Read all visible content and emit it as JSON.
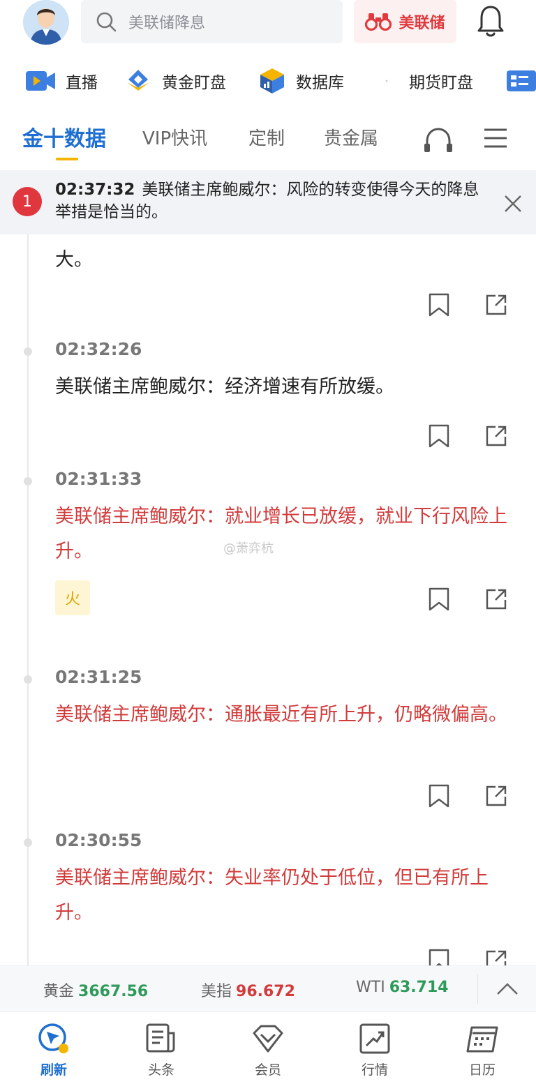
{
  "header": {
    "search_placeholder": "美联储降息",
    "brand_button": "美联储"
  },
  "quicknav": [
    {
      "label": "直播",
      "icon": "video-icon"
    },
    {
      "label": "黄金盯盘",
      "icon": "gold-icon"
    },
    {
      "label": "数据库",
      "icon": "database-icon"
    },
    {
      "label": "期货盯盘",
      "icon": "futures-icon"
    }
  ],
  "tabs": [
    {
      "label": "金十数据",
      "active": true
    },
    {
      "label": "VIP快讯",
      "active": false
    },
    {
      "label": "定制",
      "active": false
    },
    {
      "label": "贵金属",
      "active": false
    }
  ],
  "notice": {
    "badge": "1",
    "time": "02:37:32",
    "text": "美联储主席鲍威尔：风险的转变使得今天的降息举措是恰当的。"
  },
  "feed": {
    "partial_text": "大。",
    "watermark": "@萧弈杭",
    "entries": [
      {
        "time": "02:32:26",
        "text": "美联储主席鲍威尔：经济增速有所放缓。",
        "important": false
      },
      {
        "time": "02:31:33",
        "text": "美联储主席鲍威尔：就业增长已放缓，就业下行风险上升。",
        "important": true,
        "hot": "火"
      },
      {
        "time": "02:31:25",
        "text": "美联储主席鲍威尔：通胀最近有所上升，仍略微偏高。",
        "important": true
      },
      {
        "time": "02:30:55",
        "text": "美联储主席鲍威尔：失业率仍处于低位，但已有所上升。",
        "important": true
      }
    ]
  },
  "ticker": [
    {
      "name": "黄金",
      "value": "3667.56",
      "trend": "up"
    },
    {
      "name": "美指",
      "value": "96.672",
      "trend": "down"
    },
    {
      "name": "WTI",
      "value": "63.714",
      "trend": "up"
    }
  ],
  "bottomnav": [
    {
      "label": "刷新",
      "active": true
    },
    {
      "label": "头条",
      "active": false
    },
    {
      "label": "会员",
      "active": false
    },
    {
      "label": "行情",
      "active": false
    },
    {
      "label": "日历",
      "active": false
    }
  ],
  "colors": {
    "accent": "#1f6fd1",
    "important": "#d23b3b",
    "up": "#2e9a5a",
    "highlight": "#f4b400"
  }
}
